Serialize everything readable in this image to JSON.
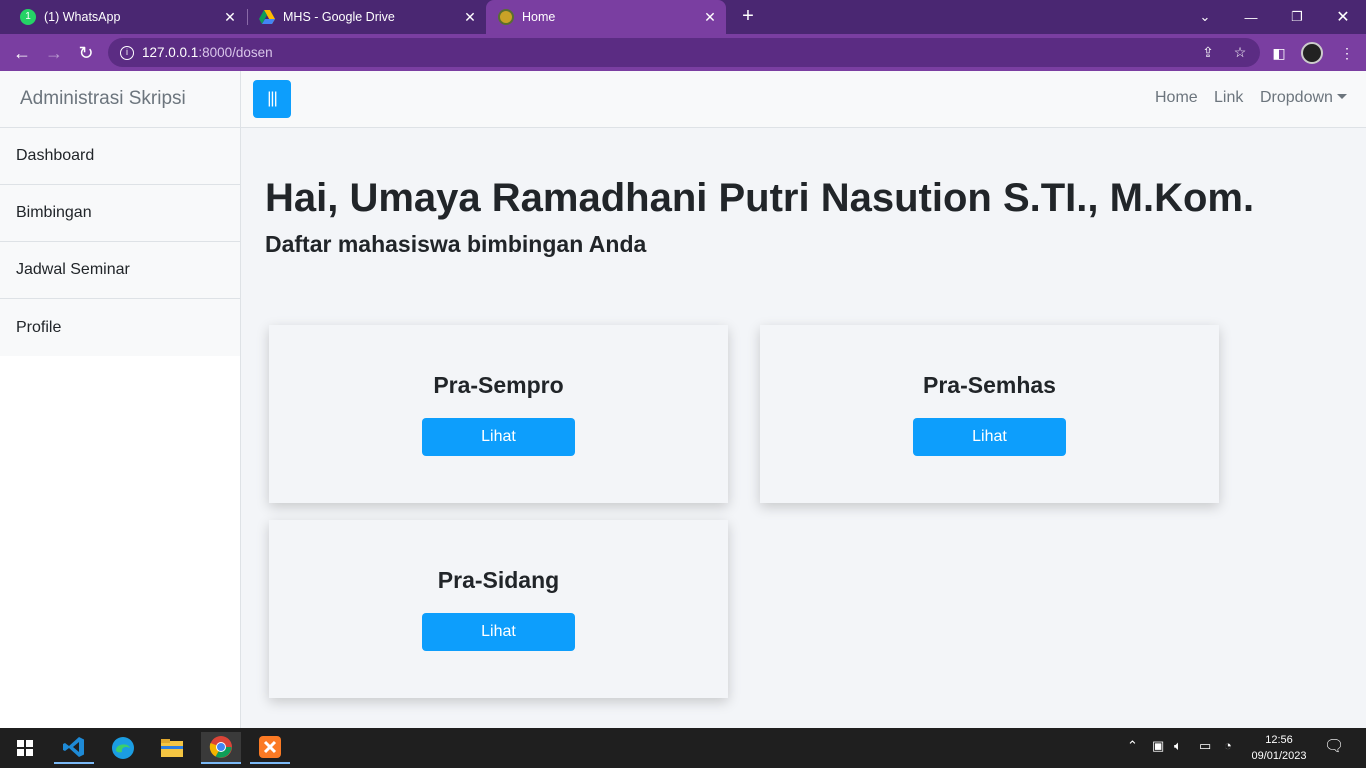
{
  "browser": {
    "tabs": [
      {
        "title": "(1) WhatsApp",
        "icon": "whatsapp-icon",
        "active": false
      },
      {
        "title": "MHS - Google Drive",
        "icon": "google-drive-icon",
        "active": false
      },
      {
        "title": "Home",
        "icon": "site-favicon-icon",
        "active": true
      }
    ],
    "url_host": "127.0.0.1",
    "url_path": ":8000/dosen",
    "colors": {
      "frame": "#4a2772",
      "toolbar": "#7a3ea1"
    }
  },
  "sidebar": {
    "heading": "Administrasi Skripsi",
    "items": [
      {
        "label": "Dashboard"
      },
      {
        "label": "Bimbingan"
      },
      {
        "label": "Jadwal Seminar"
      },
      {
        "label": "Profile"
      }
    ]
  },
  "topnav": {
    "toggle_label": "|||",
    "links": [
      {
        "label": "Home"
      },
      {
        "label": "Link"
      },
      {
        "label": "Dropdown"
      }
    ]
  },
  "main": {
    "greeting": "Hai, Umaya Ramadhani Putri Nasution S.TI., M.Kom.",
    "subtitle": "Daftar mahasiswa bimbingan Anda",
    "cards": [
      {
        "title": "Pra-Sempro",
        "button": "Lihat"
      },
      {
        "title": "Pra-Semhas",
        "button": "Lihat"
      },
      {
        "title": "Pra-Sidang",
        "button": "Lihat"
      }
    ],
    "accent_color": "#0d9efc"
  },
  "taskbar": {
    "apps": [
      "windows-start-icon",
      "vscode-icon",
      "edge-icon",
      "file-explorer-icon",
      "chrome-icon",
      "xampp-icon"
    ],
    "time": "12:56",
    "date": "09/01/2023"
  }
}
